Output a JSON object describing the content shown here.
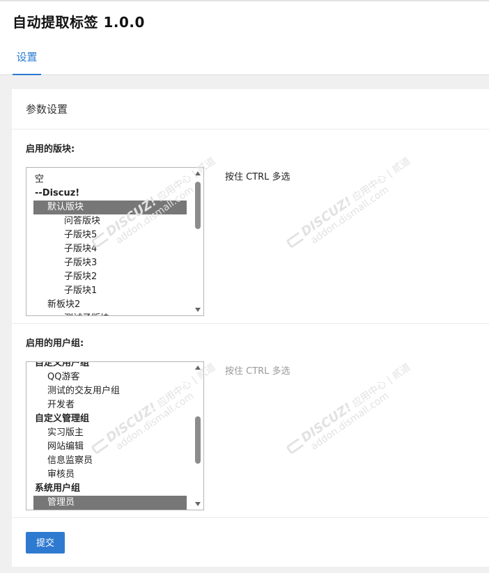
{
  "app": {
    "title": "自动提取标签 1.0.0"
  },
  "tabs": [
    {
      "label": "设置"
    }
  ],
  "panel": {
    "title": "参数设置",
    "forums": {
      "label": "启用的版块:",
      "hint": "按住 CTRL 多选",
      "options": [
        {
          "label": "空",
          "level": 0
        },
        {
          "label": "--Discuz!",
          "level": 0,
          "bold": true
        },
        {
          "label": "默认版块",
          "level": 1,
          "selected": true
        },
        {
          "label": "问答版块",
          "level": 2
        },
        {
          "label": "子版块5",
          "level": 2
        },
        {
          "label": "子版块4",
          "level": 2
        },
        {
          "label": "子版块3",
          "level": 2
        },
        {
          "label": "子版块2",
          "level": 2
        },
        {
          "label": "子版块1",
          "level": 2
        },
        {
          "label": "新板块2",
          "level": 1
        },
        {
          "label": "测试子版块",
          "level": 2
        }
      ]
    },
    "usergroups": {
      "label": "启用的用户组:",
      "hint": "按住 CTRL 多选",
      "options": [
        {
          "label": "自定义用户组",
          "group": true
        },
        {
          "label": "QQ游客",
          "level": 1
        },
        {
          "label": "测试的交友用户组",
          "level": 1
        },
        {
          "label": "开发者",
          "level": 1
        },
        {
          "label": "自定义管理组",
          "group": true
        },
        {
          "label": "实习版主",
          "level": 1
        },
        {
          "label": "网站编辑",
          "level": 1
        },
        {
          "label": "信息监察员",
          "level": 1
        },
        {
          "label": "审核员",
          "level": 1
        },
        {
          "label": "系统用户组",
          "group": true
        },
        {
          "label": "管理员",
          "level": 1,
          "selected": true
        }
      ]
    },
    "submit_label": "提交"
  },
  "watermark": {
    "brand": "DISCUZ!",
    "line1": "应用中心 | 贰道",
    "line2": "addon.dismall.com"
  },
  "colors": {
    "accent": "#2a7ad1",
    "button": "#2f7ad1",
    "selected_bg": "#777777",
    "hint_active": "#222222",
    "hint_muted": "#999999"
  }
}
